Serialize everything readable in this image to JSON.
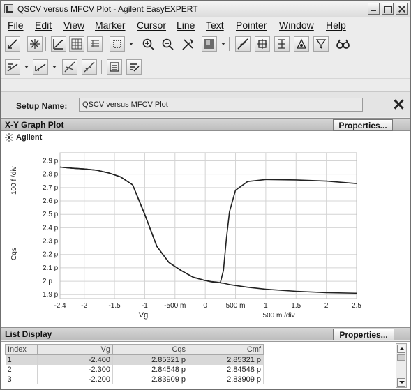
{
  "window": {
    "title": "QSCV versus MFCV Plot - Agilent EasyEXPERT"
  },
  "menu": {
    "items": [
      "File",
      "Edit",
      "View",
      "Marker",
      "Cursor",
      "Line",
      "Text",
      "Pointer",
      "Window",
      "Help"
    ]
  },
  "toolbar1": {
    "icons": [
      "scale-icon",
      "autoscale-icon",
      "trace-icon",
      "grid-icon",
      "data-icon",
      "select-icon",
      "zoom-in-icon",
      "zoom-out-icon",
      "tools-icon",
      "color-icon",
      "line-fit-icon",
      "marker-icon",
      "marker-search-icon",
      "cursor-icon",
      "cursor-filter-icon",
      "binoculars-icon"
    ]
  },
  "toolbar2": {
    "icons": [
      "line-mode-icon",
      "line-mode2-icon",
      "tangent-icon",
      "regression-icon",
      "list-icon",
      "annotate-icon"
    ]
  },
  "setup": {
    "label": "Setup Name:",
    "value": "QSCV versus MFCV Plot"
  },
  "graph_panel": {
    "title": "X-Y Graph Plot",
    "properties_label": "Properties...",
    "brand": "Agilent"
  },
  "chart_data": {
    "type": "line",
    "x": [
      -2.4,
      -2.2,
      -2.0,
      -1.8,
      -1.6,
      -1.4,
      -1.2,
      -1.0,
      -0.8,
      -0.6,
      -0.4,
      -0.2,
      0.0,
      0.1,
      0.2,
      0.25,
      0.3,
      0.35,
      0.4,
      0.5,
      0.7,
      1.0,
      1.5,
      2.0,
      2.5
    ],
    "series": [
      {
        "values": [
          2.853,
          2.845,
          2.839,
          2.83,
          2.81,
          2.78,
          2.72,
          2.5,
          2.26,
          2.14,
          2.08,
          2.03,
          2.005,
          1.995,
          1.99,
          1.99,
          2.08,
          2.32,
          2.52,
          2.68,
          2.745,
          2.76,
          2.757,
          2.748,
          2.73
        ]
      },
      {
        "values": [
          2.853,
          2.845,
          2.839,
          2.83,
          2.81,
          2.78,
          2.72,
          2.5,
          2.26,
          2.14,
          2.08,
          2.03,
          2.005,
          1.998,
          1.992,
          1.988,
          1.985,
          1.98,
          1.975,
          1.968,
          1.955,
          1.94,
          1.925,
          1.915,
          1.91
        ]
      }
    ],
    "xlim": [
      -2.4,
      2.5
    ],
    "ylim": [
      1.87,
      2.96
    ],
    "x_ticks": [
      "-2.4",
      "-2",
      "-1.5",
      "-1",
      "-500 m",
      "0",
      "500 m",
      "1",
      "1.5",
      "2",
      "2.5"
    ],
    "x_tick_values": [
      -2.4,
      -2.0,
      -1.5,
      -1.0,
      -0.5,
      0.0,
      0.5,
      1.0,
      1.5,
      2.0,
      2.5
    ],
    "y_ticks": [
      "2.9 p",
      "2.8 p",
      "2.7 p",
      "2.6 p",
      "2.5 p",
      "2.4 p",
      "2.3 p",
      "2.2 p",
      "2.1 p",
      "2 p",
      "1.9 p"
    ],
    "y_tick_values": [
      2.9,
      2.8,
      2.7,
      2.6,
      2.5,
      2.4,
      2.3,
      2.2,
      2.1,
      2.0,
      1.9
    ],
    "xlabel": "Vg",
    "ylabel": "Cqs",
    "x_div_label": "500 m /div",
    "y_div_label": "100 f /div",
    "grid": true,
    "line_color": "#222222"
  },
  "list_panel": {
    "title": "List Display",
    "properties_label": "Properties...",
    "columns": [
      "Index",
      "Vg",
      "Cqs",
      "Cmf"
    ],
    "rows": [
      [
        "1",
        "-2.400",
        "2.85321 p",
        "2.85321 p"
      ],
      [
        "2",
        "-2.300",
        "2.84548 p",
        "2.84548 p"
      ],
      [
        "3",
        "-2.200",
        "2.83909 p",
        "2.83909 p"
      ]
    ]
  }
}
